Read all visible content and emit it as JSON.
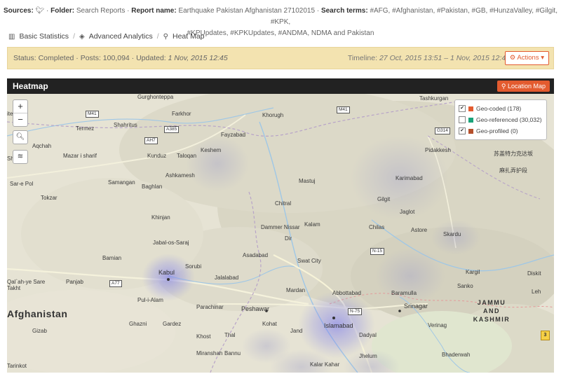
{
  "meta": {
    "sources_label": "Sources:",
    "folder_label": "Folder:",
    "folder": "Search Reports",
    "report_name_label": "Report name:",
    "report_name": "Earthquake Pakistan Afghanistan 27102015",
    "search_terms_label": "Search terms:",
    "search_terms_line1": "#AFG, #Afghanistan, #Pakistan, #GB, #HunzaValley, #Gilgit, #KPK,",
    "search_terms_line2": "#KPUpdates, #KPKUpdates, #ANDMA, NDMA and Pakistan"
  },
  "breadcrumb": {
    "basic": "Basic Statistics",
    "advanced": "Advanced Analytics",
    "heatmap": "Heat Map"
  },
  "status": {
    "text": "Status: Completed · Posts: 100,094 · Updated:",
    "updated": "1 Nov, 2015 12:45",
    "timeline_label": "Timeline:",
    "timeline": "27 Oct, 2015 13:51 – 1 Nov, 2015 12:45",
    "actions_label": "Actions"
  },
  "panel": {
    "title": "Heatmap",
    "location_button": "Location Map"
  },
  "legend": [
    {
      "label": "Geo-coded (178)",
      "checked": true,
      "color": "#e35b2f"
    },
    {
      "label": "Geo-referenced (30,032)",
      "checked": false,
      "color": "#1aa37a"
    },
    {
      "label": "Geo-profiled (0)",
      "checked": true,
      "color": "#b5502c"
    }
  ],
  "map": {
    "zoom_in": "+",
    "zoom_out": "−",
    "marker_count": "3",
    "labels": {
      "gurgantepa": "Gurghonteppa",
      "fendag": "itendag",
      "termez": "Termez",
      "shahritus": "Shahritus",
      "farkhor": "Farkhor",
      "khorugh": "Khorugh",
      "fayzabad": "Fayzabad",
      "tashkurgan": "Tashkurgan",
      "aqchah": "Aqchah",
      "shiberghan": "Shi",
      "mazar": "Mazar i sharif",
      "kunduz": "Kunduz",
      "taloqan": "Taloqan",
      "keshem": "Keshem",
      "ashkamesh": "Ashkamesh",
      "pidakkesh": "Pidakkesh",
      "sarepol": "Sar-e Pol",
      "samangan": "Samangan",
      "baghlan": "Baghlan",
      "mastuj": "Mastuj",
      "karimabad": "Karimabad",
      "gilgit": "Gilgit",
      "jaglot": "Jaglot",
      "tokzar": "Tokzar",
      "chitral": "Chitral",
      "khinjan": "Khinjan",
      "dammer": "Dammer Nissar",
      "kalam": "Kalam",
      "chilas": "Chilas",
      "astore": "Astore",
      "skardu": "Skardu",
      "dir": "Dir",
      "jabal": "Jabal-os-Saraj",
      "asadabad": "Asadabad",
      "bamian": "Bamian",
      "swat": "Swat City",
      "kabul": "Kabul",
      "sorubi": "Sorubi",
      "jalalabad": "Jalalabad",
      "kargil": "Kargil",
      "diskit": "Diskit",
      "qalah": "Qal`ah-ye Sare Takht",
      "panjab": "Panjab",
      "mardan": "Mardan",
      "abbottabad": "Abbottabad",
      "baramulla": "Baramulla",
      "sanko": "Sanko",
      "leh": "Leh",
      "afghanistan": "Afghanistan",
      "pulialam": "Pul-i-Alam",
      "parachinar": "Parachinar",
      "peshawar": "Peshawar",
      "srinagar": "Srinagar",
      "jammu": "JAMMU",
      "and": "AND",
      "kashmir": "KASHMIR",
      "ghazni": "Ghazni",
      "gardez": "Gardez",
      "kohat": "Kohat",
      "islamabad": "Islamabad",
      "verinag": "Verinag",
      "gizab": "Gizab",
      "khost": "Khost",
      "thal": "Thal",
      "jand": "Jand",
      "dadyal": "Dadyal",
      "miranshah": "Miranshah",
      "bannu": "Bannu",
      "jhelum": "Jhelum",
      "bhaderwah": "Bhaderwah",
      "tarinkot": "Tarinkot",
      "kalarkahar": "Kalar Kahar",
      "chinese1": "苏盖特力克达坂",
      "chinese2": "麻扎弄护段",
      "m41a": "M41",
      "m41b": "M41",
      "a385": "A385",
      "ah7": "AH7",
      "g314": "G314",
      "a77": "A77",
      "n15": "N-15",
      "n75": "N-75"
    }
  }
}
